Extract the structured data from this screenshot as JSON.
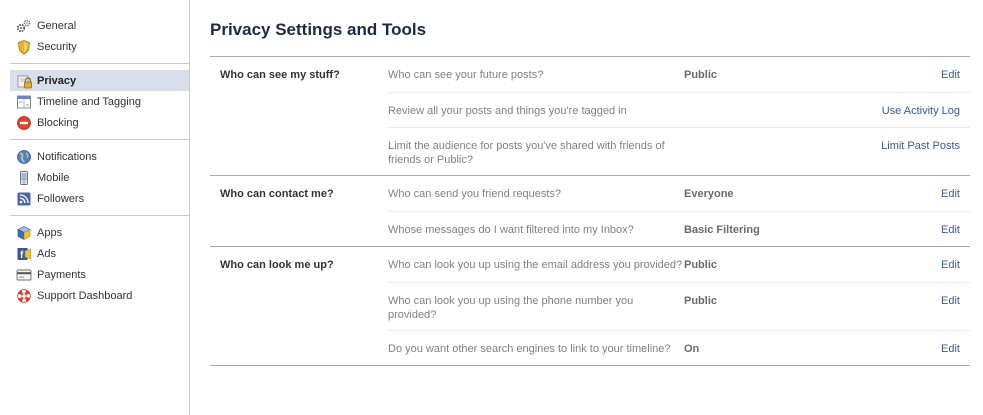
{
  "sidebar": {
    "groups": [
      [
        {
          "label": "General",
          "icon": "gears-icon"
        },
        {
          "label": "Security",
          "icon": "shield-icon"
        }
      ],
      [
        {
          "label": "Privacy",
          "icon": "lock-icon",
          "selected": true
        },
        {
          "label": "Timeline and Tagging",
          "icon": "timeline-icon"
        },
        {
          "label": "Blocking",
          "icon": "block-icon"
        }
      ],
      [
        {
          "label": "Notifications",
          "icon": "globe-icon"
        },
        {
          "label": "Mobile",
          "icon": "phone-icon"
        },
        {
          "label": "Followers",
          "icon": "rss-icon"
        }
      ],
      [
        {
          "label": "Apps",
          "icon": "apps-icon"
        },
        {
          "label": "Ads",
          "icon": "ads-icon"
        },
        {
          "label": "Payments",
          "icon": "card-icon"
        },
        {
          "label": "Support Dashboard",
          "icon": "lifebuoy-icon"
        }
      ]
    ]
  },
  "main": {
    "title": "Privacy Settings and Tools",
    "sections": [
      {
        "title": "Who can see my stuff?",
        "rows": [
          {
            "question": "Who can see your future posts?",
            "value": "Public",
            "action": "Edit"
          },
          {
            "question": "Review all your posts and things you're tagged in",
            "value": "",
            "action": "Use Activity Log"
          },
          {
            "question": "Limit the audience for posts you've shared with friends of friends or Public?",
            "value": "",
            "action": "Limit Past Posts"
          }
        ]
      },
      {
        "title": "Who can contact me?",
        "rows": [
          {
            "question": "Who can send you friend requests?",
            "value": "Everyone",
            "action": "Edit"
          },
          {
            "question": "Whose messages do I want filtered into my Inbox?",
            "value": "Basic Filtering",
            "action": "Edit"
          }
        ]
      },
      {
        "title": "Who can look me up?",
        "rows": [
          {
            "question": "Who can look you up using the email address you provided?",
            "value": "Public",
            "action": "Edit"
          },
          {
            "question": "Who can look you up using the phone number you provided?",
            "value": "Public",
            "action": "Edit"
          },
          {
            "question": "Do you want other search engines to link to your timeline?",
            "value": "On",
            "action": "Edit"
          }
        ]
      }
    ]
  }
}
